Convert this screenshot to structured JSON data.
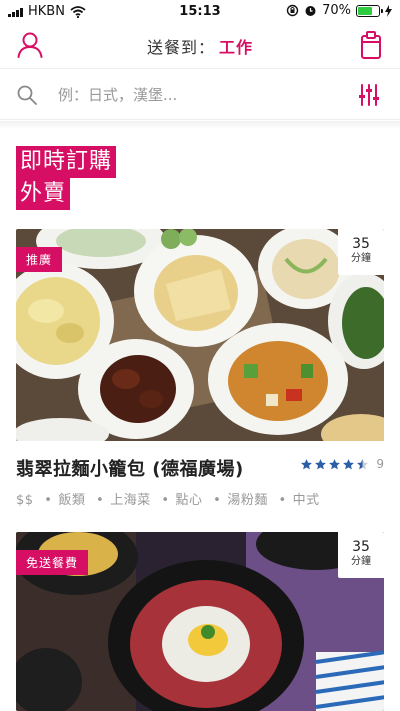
{
  "status_bar": {
    "carrier": "HKBN",
    "time": "15:13",
    "battery_percent": "70%",
    "battery_level": 0.7,
    "icons": [
      "signal-icon",
      "wifi-icon",
      "rotation-lock-icon",
      "alarm-icon",
      "battery-icon",
      "charging-icon"
    ]
  },
  "header": {
    "user_icon": "user-icon",
    "deliver_prefix": "送餐到：",
    "deliver_address": "工作",
    "cart_icon": "cart-icon"
  },
  "search": {
    "placeholder": "例：日式，漢堡...",
    "value": "",
    "icon": "search-icon",
    "filter_icon": "filter-sliders-icon"
  },
  "banner": {
    "line1": "即時訂購",
    "line2": "外賣"
  },
  "restaurants": [
    {
      "tag": "推廣",
      "eta_value": "35",
      "eta_unit": "分鐘",
      "name": "翡翠拉麵小籠包 (德福廣場)",
      "rating_stars": 4.5,
      "rating_count": "9",
      "price": "$$",
      "cuisines": [
        "飯類",
        "上海菜",
        "點心",
        "湯粉麵",
        "中式"
      ]
    },
    {
      "tag": "免送餐費",
      "eta_value": "35",
      "eta_unit": "分鐘"
    }
  ],
  "colors": {
    "brand": "#d70f64",
    "star": "#2c5fa8",
    "muted_text": "#999999"
  }
}
